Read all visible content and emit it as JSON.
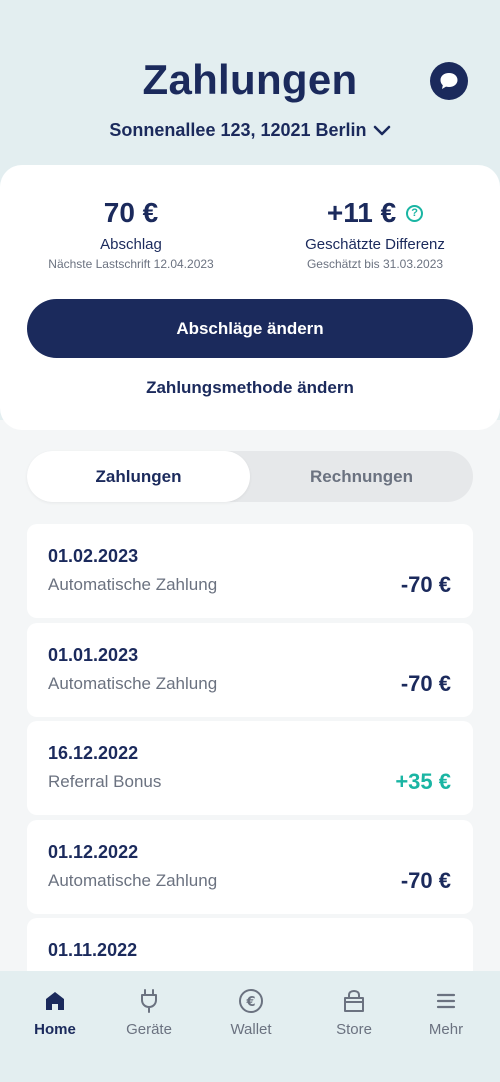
{
  "header": {
    "title": "Zahlungen",
    "address": "Sonnenallee 123, 12021 Berlin"
  },
  "summary": {
    "left": {
      "value": "70 €",
      "label": "Abschlag",
      "sub": "Nächste Lastschrift 12.04.2023"
    },
    "right": {
      "value": "+11 €",
      "label": "Geschätzte Differenz",
      "sub": "Geschätzt bis 31.03.2023",
      "help": "?"
    },
    "primary_button": "Abschläge ändern",
    "secondary_button": "Zahlungsmethode ändern"
  },
  "tabs": [
    {
      "label": "Zahlungen",
      "active": true
    },
    {
      "label": "Rechnungen",
      "active": false
    }
  ],
  "transactions": [
    {
      "date": "01.02.2023",
      "desc": "Automatische Zahlung",
      "amount": "-70 €"
    },
    {
      "date": "01.01.2023",
      "desc": "Automatische Zahlung",
      "amount": "-70 €"
    },
    {
      "date": "16.12.2022",
      "desc": "Referral Bonus",
      "amount": "+35 €"
    },
    {
      "date": "01.12.2022",
      "desc": "Automatische Zahlung",
      "amount": "-70 €"
    },
    {
      "date": "01.11.2022",
      "desc": "",
      "amount": ""
    }
  ],
  "nav": [
    {
      "label": "Home",
      "icon": "home-icon"
    },
    {
      "label": "Geräte",
      "icon": "plug-icon"
    },
    {
      "label": "Wallet",
      "icon": "euro-icon"
    },
    {
      "label": "Store",
      "icon": "bag-icon"
    },
    {
      "label": "Mehr",
      "icon": "menu-icon"
    }
  ],
  "colors": {
    "navy": "#1b2a5c",
    "teal": "#1ab5a3",
    "background": "#e3eef0"
  }
}
